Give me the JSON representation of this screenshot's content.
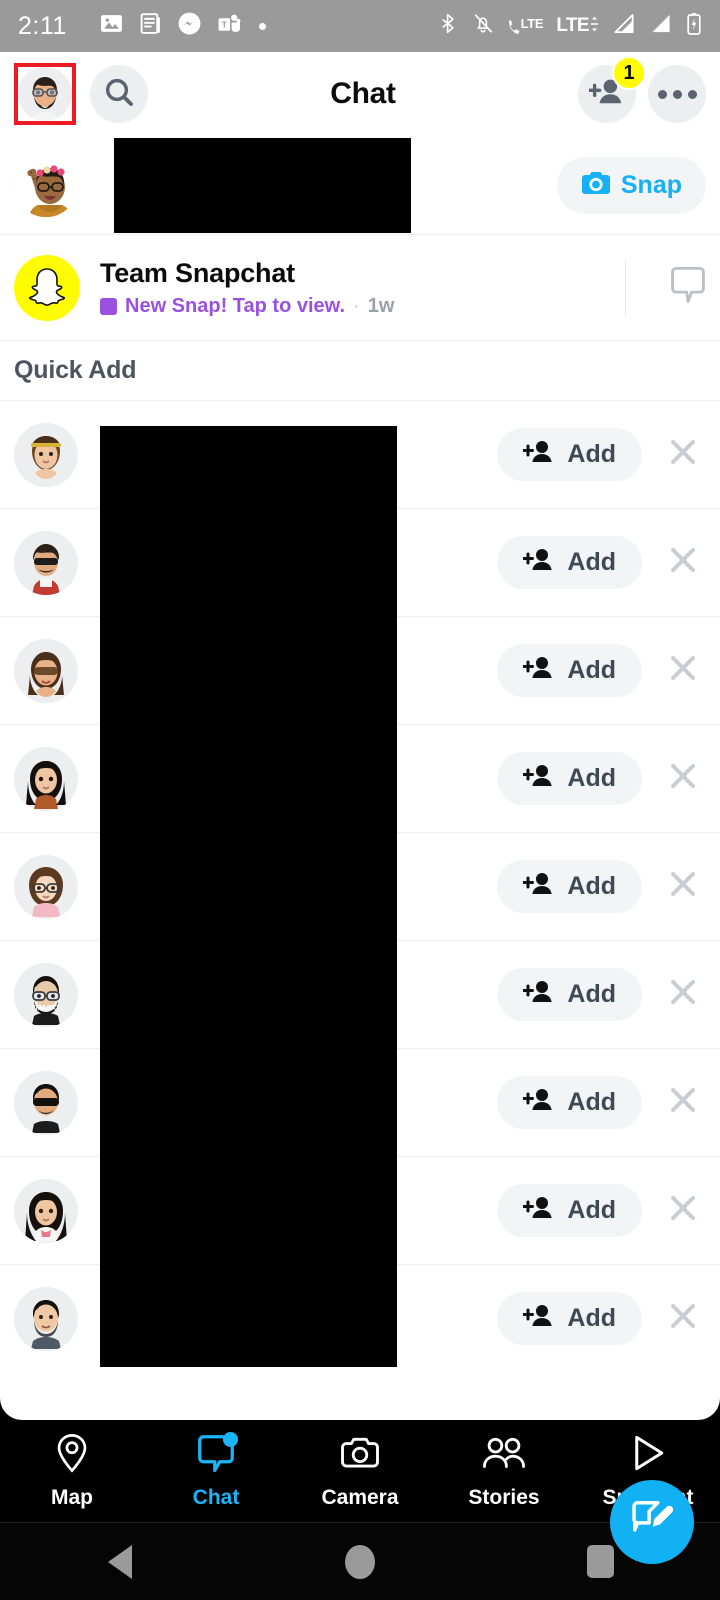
{
  "statusbar": {
    "time": "2:11",
    "left_icons": [
      "photo-icon",
      "news-icon",
      "messenger-icon",
      "teams-icon",
      "dot-icon"
    ],
    "right_icons": [
      "bluetooth-icon",
      "notifications-muted-icon",
      "volte-icon",
      "lte-plus-icon",
      "signal-1-icon",
      "signal-2-icon",
      "battery-charging-icon"
    ],
    "lte_call_label": "LTE",
    "lte_data_label": "LTE",
    "background": "#9a9a9a"
  },
  "header": {
    "title": "Chat",
    "profile_icon": "profile-avatar",
    "search_icon": "search-icon",
    "add_friend_icon": "add-friend-icon",
    "add_friend_badge": "1",
    "more_icon": "more-options-icon",
    "badge_color": "#fffc00",
    "highlight_color": "#ee1b24"
  },
  "conversation_row": {
    "avatar_icon": "friend-bitmoji-avatar",
    "name_redacted": true,
    "snap_button_label": "Snap",
    "snap_icon": "camera-icon",
    "snap_color": "#15b0f5"
  },
  "team_snapchat": {
    "name": "Team Snapchat",
    "status": "New Snap! Tap to view.",
    "separator": "·",
    "time": "1w",
    "status_color": "#9b51e0",
    "avatar_icon": "snapchat-ghost-icon",
    "chat_icon": "chat-bubble-icon"
  },
  "quick_add": {
    "title": "Quick Add",
    "add_label": "Add",
    "add_icon": "add-person-icon",
    "dismiss_icon": "close-icon",
    "items": [
      {
        "avatar": "bitmoji-girl-headband",
        "name_redacted": true
      },
      {
        "avatar": "bitmoji-man-sunglasses-red",
        "name_redacted": true
      },
      {
        "avatar": "bitmoji-woman-sunglasses",
        "name_redacted": true
      },
      {
        "avatar": "bitmoji-woman-black-hair",
        "name_redacted": true
      },
      {
        "avatar": "bitmoji-woman-glasses-curly",
        "name_redacted": true
      },
      {
        "avatar": "bitmoji-man-mask-glasses",
        "name_redacted": true
      },
      {
        "avatar": "bitmoji-man-sunglasses-black",
        "name_redacted": true
      },
      {
        "avatar": "bitmoji-woman-long-hair",
        "name_redacted": true
      },
      {
        "avatar": "bitmoji-man-beard-grey",
        "name_redacted": true
      }
    ]
  },
  "fab": {
    "icon": "new-chat-icon",
    "color": "#12b1f3"
  },
  "bottom_nav": {
    "items": [
      {
        "label": "Map",
        "icon": "map-pin-icon",
        "active": false,
        "has_dot": false
      },
      {
        "label": "Chat",
        "icon": "chat-bubble-icon",
        "active": true,
        "has_dot": true
      },
      {
        "label": "Camera",
        "icon": "camera-icon",
        "active": false,
        "has_dot": false
      },
      {
        "label": "Stories",
        "icon": "stories-people-icon",
        "active": false,
        "has_dot": false
      },
      {
        "label": "Spotlight",
        "icon": "play-triangle-icon",
        "active": false,
        "has_dot": false
      }
    ],
    "active_color": "#19b5f7"
  },
  "system_nav": {
    "items": [
      "back-button",
      "home-button",
      "recents-button"
    ]
  }
}
